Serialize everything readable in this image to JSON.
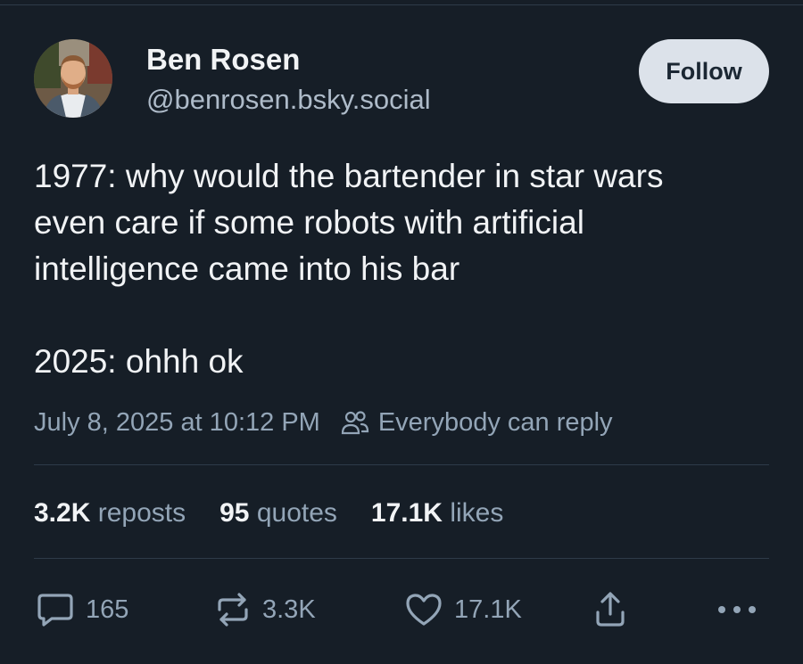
{
  "author": {
    "display_name": "Ben Rosen",
    "handle": "@benrosen.bsky.social"
  },
  "follow_label": "Follow",
  "post": {
    "lines": [
      "1977: why would the bartender in star wars",
      "even care if some robots with artificial",
      "intelligence came into his bar",
      "2025: ohhh ok"
    ]
  },
  "meta": {
    "timestamp": "July 8, 2025 at 10:12 PM",
    "reply_setting": "Everybody can reply"
  },
  "stats": {
    "reposts": {
      "count": "3.2K",
      "label": "reposts"
    },
    "quotes": {
      "count": "95",
      "label": "quotes"
    },
    "likes": {
      "count": "17.1K",
      "label": "likes"
    }
  },
  "actions": {
    "reply": {
      "icon": "speech-bubble-icon",
      "count": "165"
    },
    "repost": {
      "icon": "repost-icon",
      "count": "3.3K"
    },
    "like": {
      "icon": "heart-icon",
      "count": "17.1K"
    },
    "share": {
      "icon": "share-icon"
    },
    "more": {
      "icon": "more-dots-icon"
    }
  },
  "colors": {
    "background": "#161e27",
    "primary_text": "#f1f3f5",
    "secondary_text": "#93a5b7",
    "follow_button_bg": "#dce2ea"
  }
}
